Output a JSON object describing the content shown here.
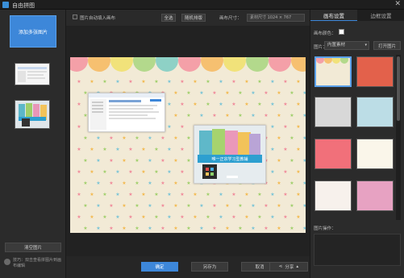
{
  "window": {
    "title": "自由拼图",
    "close_glyph": "✕"
  },
  "left": {
    "add_button": "添加多张图片",
    "clear_button": "清空图片",
    "tip": "技巧：双击查看拼图片到画布编辑"
  },
  "toolbar": {
    "auto_fill_label": "图片自动填入画布",
    "select_all": "全选",
    "random_layout": "随机排版",
    "canvas_size_label": "画布尺寸：",
    "canvas_size_value": "素材尺寸 1024 × 767"
  },
  "canvas": {
    "photo2_caption": "唯一正宗学习型教辅"
  },
  "bottom": {
    "ok": "确定",
    "save_as": "另存为",
    "cancel": "取消",
    "share": "分享"
  },
  "right": {
    "tabs": [
      "画布设置",
      "边框设置"
    ],
    "color_label": "画布颜色：",
    "color_value": "#ffffff",
    "picture_label": "图片：",
    "picture_select": "内置素材",
    "open_button": "打开图片",
    "ops_label": "图片操作："
  },
  "colors": {
    "accent": "#3d87d9",
    "canvas_bg": "#f2ead6"
  }
}
